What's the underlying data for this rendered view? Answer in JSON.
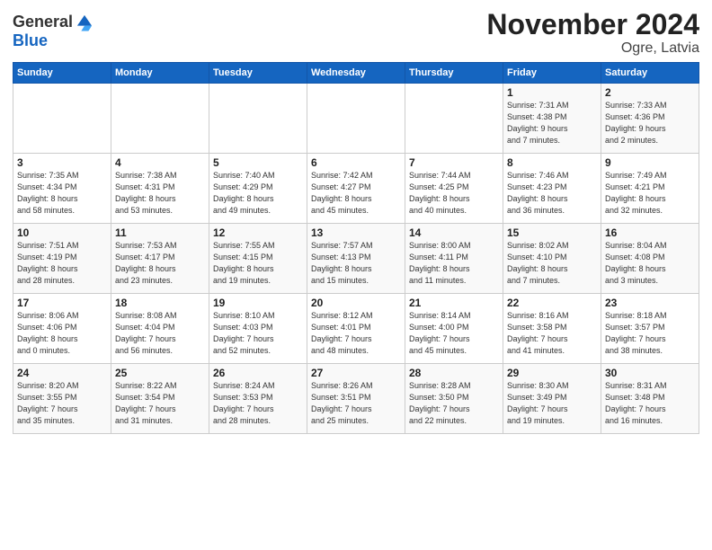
{
  "logo": {
    "general": "General",
    "blue": "Blue"
  },
  "header": {
    "month": "November 2024",
    "location": "Ogre, Latvia"
  },
  "weekdays": [
    "Sunday",
    "Monday",
    "Tuesday",
    "Wednesday",
    "Thursday",
    "Friday",
    "Saturday"
  ],
  "weeks": [
    [
      {
        "day": "",
        "info": ""
      },
      {
        "day": "",
        "info": ""
      },
      {
        "day": "",
        "info": ""
      },
      {
        "day": "",
        "info": ""
      },
      {
        "day": "",
        "info": ""
      },
      {
        "day": "1",
        "info": "Sunrise: 7:31 AM\nSunset: 4:38 PM\nDaylight: 9 hours\nand 7 minutes."
      },
      {
        "day": "2",
        "info": "Sunrise: 7:33 AM\nSunset: 4:36 PM\nDaylight: 9 hours\nand 2 minutes."
      }
    ],
    [
      {
        "day": "3",
        "info": "Sunrise: 7:35 AM\nSunset: 4:34 PM\nDaylight: 8 hours\nand 58 minutes."
      },
      {
        "day": "4",
        "info": "Sunrise: 7:38 AM\nSunset: 4:31 PM\nDaylight: 8 hours\nand 53 minutes."
      },
      {
        "day": "5",
        "info": "Sunrise: 7:40 AM\nSunset: 4:29 PM\nDaylight: 8 hours\nand 49 minutes."
      },
      {
        "day": "6",
        "info": "Sunrise: 7:42 AM\nSunset: 4:27 PM\nDaylight: 8 hours\nand 45 minutes."
      },
      {
        "day": "7",
        "info": "Sunrise: 7:44 AM\nSunset: 4:25 PM\nDaylight: 8 hours\nand 40 minutes."
      },
      {
        "day": "8",
        "info": "Sunrise: 7:46 AM\nSunset: 4:23 PM\nDaylight: 8 hours\nand 36 minutes."
      },
      {
        "day": "9",
        "info": "Sunrise: 7:49 AM\nSunset: 4:21 PM\nDaylight: 8 hours\nand 32 minutes."
      }
    ],
    [
      {
        "day": "10",
        "info": "Sunrise: 7:51 AM\nSunset: 4:19 PM\nDaylight: 8 hours\nand 28 minutes."
      },
      {
        "day": "11",
        "info": "Sunrise: 7:53 AM\nSunset: 4:17 PM\nDaylight: 8 hours\nand 23 minutes."
      },
      {
        "day": "12",
        "info": "Sunrise: 7:55 AM\nSunset: 4:15 PM\nDaylight: 8 hours\nand 19 minutes."
      },
      {
        "day": "13",
        "info": "Sunrise: 7:57 AM\nSunset: 4:13 PM\nDaylight: 8 hours\nand 15 minutes."
      },
      {
        "day": "14",
        "info": "Sunrise: 8:00 AM\nSunset: 4:11 PM\nDaylight: 8 hours\nand 11 minutes."
      },
      {
        "day": "15",
        "info": "Sunrise: 8:02 AM\nSunset: 4:10 PM\nDaylight: 8 hours\nand 7 minutes."
      },
      {
        "day": "16",
        "info": "Sunrise: 8:04 AM\nSunset: 4:08 PM\nDaylight: 8 hours\nand 3 minutes."
      }
    ],
    [
      {
        "day": "17",
        "info": "Sunrise: 8:06 AM\nSunset: 4:06 PM\nDaylight: 8 hours\nand 0 minutes."
      },
      {
        "day": "18",
        "info": "Sunrise: 8:08 AM\nSunset: 4:04 PM\nDaylight: 7 hours\nand 56 minutes."
      },
      {
        "day": "19",
        "info": "Sunrise: 8:10 AM\nSunset: 4:03 PM\nDaylight: 7 hours\nand 52 minutes."
      },
      {
        "day": "20",
        "info": "Sunrise: 8:12 AM\nSunset: 4:01 PM\nDaylight: 7 hours\nand 48 minutes."
      },
      {
        "day": "21",
        "info": "Sunrise: 8:14 AM\nSunset: 4:00 PM\nDaylight: 7 hours\nand 45 minutes."
      },
      {
        "day": "22",
        "info": "Sunrise: 8:16 AM\nSunset: 3:58 PM\nDaylight: 7 hours\nand 41 minutes."
      },
      {
        "day": "23",
        "info": "Sunrise: 8:18 AM\nSunset: 3:57 PM\nDaylight: 7 hours\nand 38 minutes."
      }
    ],
    [
      {
        "day": "24",
        "info": "Sunrise: 8:20 AM\nSunset: 3:55 PM\nDaylight: 7 hours\nand 35 minutes."
      },
      {
        "day": "25",
        "info": "Sunrise: 8:22 AM\nSunset: 3:54 PM\nDaylight: 7 hours\nand 31 minutes."
      },
      {
        "day": "26",
        "info": "Sunrise: 8:24 AM\nSunset: 3:53 PM\nDaylight: 7 hours\nand 28 minutes."
      },
      {
        "day": "27",
        "info": "Sunrise: 8:26 AM\nSunset: 3:51 PM\nDaylight: 7 hours\nand 25 minutes."
      },
      {
        "day": "28",
        "info": "Sunrise: 8:28 AM\nSunset: 3:50 PM\nDaylight: 7 hours\nand 22 minutes."
      },
      {
        "day": "29",
        "info": "Sunrise: 8:30 AM\nSunset: 3:49 PM\nDaylight: 7 hours\nand 19 minutes."
      },
      {
        "day": "30",
        "info": "Sunrise: 8:31 AM\nSunset: 3:48 PM\nDaylight: 7 hours\nand 16 minutes."
      }
    ]
  ]
}
